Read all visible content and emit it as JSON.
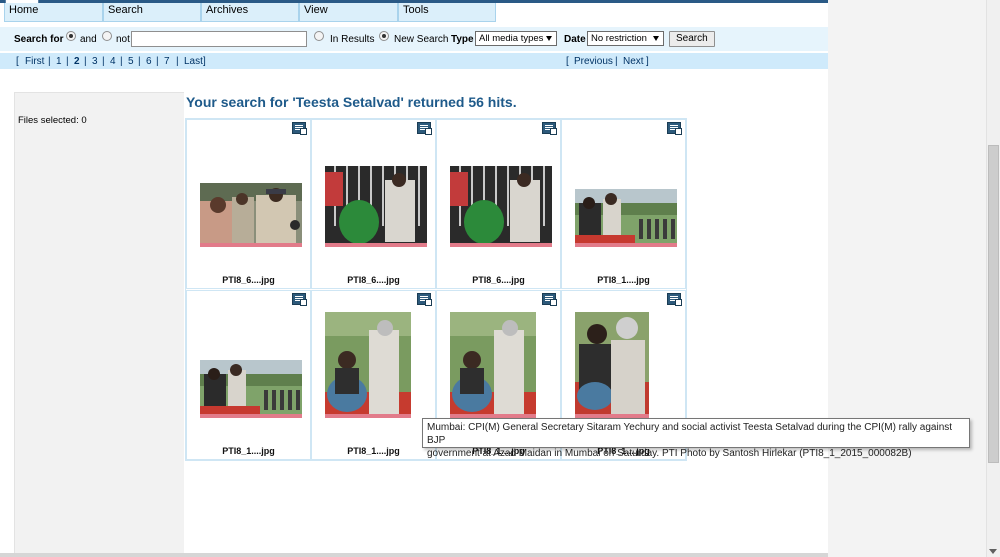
{
  "menu": {
    "items": [
      {
        "label": "Home"
      },
      {
        "label": "Search"
      },
      {
        "label": "Archives"
      },
      {
        "label": "View"
      },
      {
        "label": "Tools"
      }
    ]
  },
  "search": {
    "search_for_label": "Search for",
    "and_label": "and",
    "not_label": "not",
    "query_value": "",
    "in_results_label": "In Results",
    "new_search_label": "New Search",
    "type_label": "Type",
    "type_value": "All media types",
    "date_label": "Date",
    "date_value": "No restriction",
    "search_button": "Search"
  },
  "pager": {
    "first": "First",
    "pages": [
      "1",
      "2",
      "3",
      "4",
      "5",
      "6",
      "7"
    ],
    "current": "2",
    "last": "Last",
    "previous": "Previous",
    "next": "Next"
  },
  "side": {
    "files_selected": "Files selected: 0"
  },
  "results": {
    "title": "Your search for 'Teesta Setalvad' returned 56 hits.",
    "items": [
      {
        "filename": "PTI8_6....jpg"
      },
      {
        "filename": "PTI8_6....jpg"
      },
      {
        "filename": "PTI8_6....jpg"
      },
      {
        "filename": "PTI8_1....jpg"
      },
      {
        "filename": "PTI8_1....jpg"
      },
      {
        "filename": "PTI8_1....jpg"
      },
      {
        "filename": "PTI8_1....jpg"
      },
      {
        "filename": "PTI8_1....jpg"
      }
    ]
  },
  "tooltip": {
    "line1": "Mumbai: CPI(M) General Secretary Sitaram Yechury and social activist Teesta Setalvad during the CPI(M) rally against BJP",
    "line2": "government at Azad Maidan in Mumbai on Saturday. PTI Photo by Santosh Hirlekar  (PTI8_1_2015_000082B)"
  },
  "colors": {
    "accent": "#1e5a8a",
    "menu_bg": "#dbeffa",
    "search_bg": "#e6f4fc",
    "pager_bg": "#cfeafb"
  }
}
